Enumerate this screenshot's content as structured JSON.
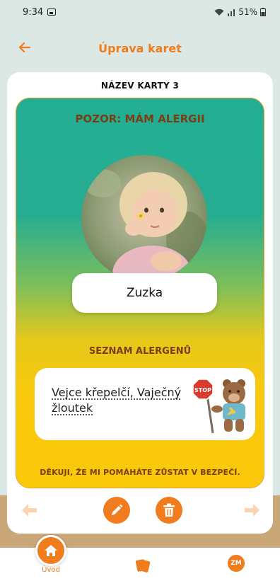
{
  "status": {
    "time": "9:34",
    "battery": "51%"
  },
  "appbar": {
    "title": "Úprava karet"
  },
  "card": {
    "name": "NÁZEV KARTY 3",
    "alert_title": "POZOR: MÁM ALERGII",
    "person_name": "Zuzka",
    "allergen_title": "SEZNAM ALERGENŮ",
    "allergens": "Vejce křepelčí, Vaječný žloutek",
    "footer": "DĚKUJI, ŽE MI POMÁHÁTE ZŮSTAT V BEZPEČÍ.",
    "stop_sign": "STOP"
  },
  "bottom_nav": {
    "home_label": "Úvod",
    "profile_initials": "ZM"
  },
  "colors": {
    "accent": "#f07c1e",
    "title_text": "#7a3e14",
    "gradient_top": "#23ae94",
    "gradient_bottom": "#fbc80a"
  },
  "icons": {
    "back": "arrow-left-icon",
    "edit": "pencil-icon",
    "delete": "trash-icon",
    "home": "home-icon",
    "cards": "cards-icon"
  }
}
